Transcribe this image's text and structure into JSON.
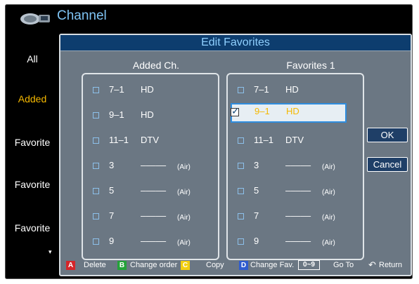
{
  "header": {
    "title": "Channel"
  },
  "sidebar": {
    "items": [
      {
        "label": "All"
      },
      {
        "label": "Added"
      },
      {
        "label": "Favorite"
      },
      {
        "label": "Favorite"
      },
      {
        "label": "Favorite"
      }
    ],
    "more_arrow": "▾"
  },
  "dialog": {
    "title": "Edit Favorites",
    "left_header": "Added Ch.",
    "right_header": "Favorites 1",
    "left_rows": [
      {
        "num": "7–1",
        "name": "HD",
        "tag": "",
        "checked": false
      },
      {
        "num": "9–1",
        "name": "HD",
        "tag": "",
        "checked": false
      },
      {
        "num": "11–1",
        "name": "DTV",
        "tag": "",
        "checked": false
      },
      {
        "num": "3",
        "name": "–––––",
        "tag": "(Air)",
        "checked": false
      },
      {
        "num": "5",
        "name": "–––––",
        "tag": "(Air)",
        "checked": false
      },
      {
        "num": "7",
        "name": "–––––",
        "tag": "(Air)",
        "checked": false
      },
      {
        "num": "9",
        "name": "–––––",
        "tag": "(Air)",
        "checked": false
      }
    ],
    "right_rows": [
      {
        "num": "7–1",
        "name": "HD",
        "tag": "",
        "checked": false
      },
      {
        "num": "9–1",
        "name": "HD",
        "tag": "",
        "checked": true,
        "selected": true
      },
      {
        "num": "11–1",
        "name": "DTV",
        "tag": "",
        "checked": false
      },
      {
        "num": "3",
        "name": "–––––",
        "tag": "(Air)",
        "checked": false
      },
      {
        "num": "5",
        "name": "–––––",
        "tag": "(Air)",
        "checked": false
      },
      {
        "num": "7",
        "name": "–––––",
        "tag": "(Air)",
        "checked": false
      },
      {
        "num": "9",
        "name": "–––––",
        "tag": "(Air)",
        "checked": false
      }
    ],
    "ok_label": "OK",
    "cancel_label": "Cancel"
  },
  "footer": {
    "keys": [
      {
        "key": "A",
        "label": "Delete",
        "color": "#d4262a"
      },
      {
        "key": "B",
        "label": "Change order",
        "color": "#23a23a"
      },
      {
        "key": "C",
        "label": "Copy",
        "color": "#f2cf10"
      },
      {
        "key": "D",
        "label": "Change Fav.",
        "color": "#2f5ccf"
      }
    ],
    "num_key": "0~9",
    "num_label": "Go To",
    "return_icon": "↶",
    "return_label": "Return"
  },
  "colors": {
    "accent_blue": "#7fc4f4",
    "active_yellow": "#f5b800",
    "dialog_title_bar": "#0d3d6e",
    "panel_gray": "#6b7783"
  }
}
